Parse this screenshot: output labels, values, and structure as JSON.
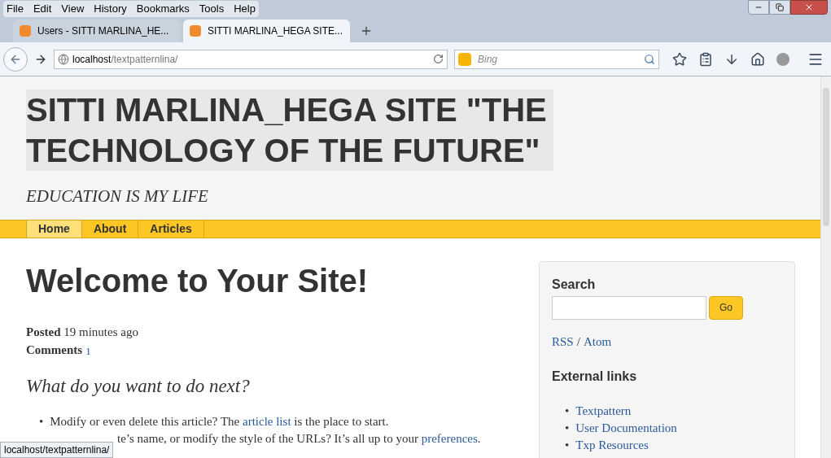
{
  "menu_bar": [
    "File",
    "Edit",
    "View",
    "History",
    "Bookmarks",
    "Tools",
    "Help"
  ],
  "tabs": [
    {
      "label": "Users - SITTI MARLINA_HE...",
      "selected": false
    },
    {
      "label": "SITTI MARLINA_HEGA SITE...",
      "selected": true
    }
  ],
  "address_bar": {
    "host": "localhost",
    "path": "/textpatternlina/"
  },
  "search_bar": {
    "placeholder": "Bing"
  },
  "site": {
    "title": "SITTI MARLINA_HEGA SITE \"THE TECHNOLOGY OF THE FUTURE\"",
    "tagline": "EDUCATION IS MY LIFE",
    "nav": [
      {
        "label": "Home",
        "selected": true
      },
      {
        "label": "About",
        "selected": false
      },
      {
        "label": "Articles",
        "selected": false
      }
    ]
  },
  "article": {
    "heading": "Welcome to Your Site!",
    "posted_label": "Posted",
    "posted_value": "19 minutes ago",
    "comments_label": "Comments",
    "comments_value": "1",
    "subheading": "What do you want to do next?",
    "bullet": "•",
    "items": [
      [
        {
          "kind": "text",
          "text": "Modify or even delete this article? The "
        },
        {
          "kind": "link",
          "text": "article list"
        },
        {
          "kind": "text",
          "text": " is the place to start."
        }
      ],
      [
        {
          "kind": "text",
          "text": "te’s name, or modify the style of the URLs? It’s all up to your "
        },
        {
          "kind": "link",
          "text": "preferences"
        },
        {
          "kind": "text",
          "text": "."
        }
      ]
    ]
  },
  "sidebar": {
    "search_heading": "Search",
    "search_button": "Go",
    "feed_links": [
      "RSS",
      "Atom"
    ],
    "feed_separator": "/",
    "links_heading": "External links",
    "bullet": "•",
    "links": [
      "Textpattern",
      "User Documentation",
      "Txp Resources"
    ]
  },
  "status_bar": "localhost/textpatternlina/"
}
